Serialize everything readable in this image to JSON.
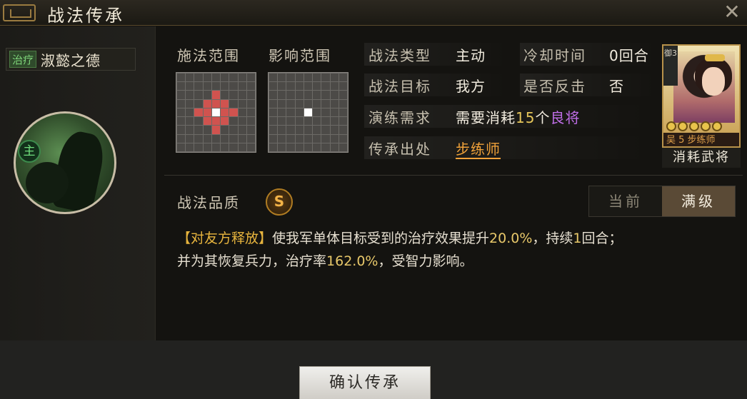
{
  "window": {
    "title": "战法传承"
  },
  "skill": {
    "type_tag": "治疗",
    "name": "淑懿之德",
    "main_badge": "主"
  },
  "ranges": {
    "cast_label": "施法范围",
    "effect_label": "影响范围",
    "cast_grid": {
      "size": 9,
      "red": [
        [
          3,
          4
        ],
        [
          4,
          3
        ],
        [
          4,
          5
        ],
        [
          5,
          4
        ],
        [
          2,
          4
        ],
        [
          4,
          2
        ],
        [
          4,
          6
        ],
        [
          6,
          4
        ],
        [
          3,
          3
        ],
        [
          3,
          5
        ],
        [
          5,
          3
        ],
        [
          5,
          5
        ]
      ],
      "white": [
        [
          4,
          4
        ]
      ]
    },
    "effect_grid": {
      "size": 9,
      "red": [],
      "white": [
        [
          4,
          4
        ]
      ]
    }
  },
  "info": {
    "type_label": "战法类型",
    "type_value": "主动",
    "cooldown_label": "冷却时间",
    "cooldown_value": "0回合",
    "target_label": "战法目标",
    "target_value": "我方",
    "counter_label": "是否反击",
    "counter_value": "否",
    "train_label": "演练需求",
    "train_prefix": "需要消耗",
    "train_count": "15",
    "train_unit": "个",
    "train_quality": "良将",
    "source_label": "传承出处",
    "source_value": "步练师"
  },
  "general_card": {
    "rank_text": "御3",
    "stars": 5,
    "faction_info": "吴 5  步练师",
    "caption": "消耗武将"
  },
  "quality": {
    "label": "战法品质",
    "grade": "S"
  },
  "level_toggle": {
    "current": "当前",
    "max": "满级",
    "active": "max"
  },
  "description": {
    "tag": "【对友方释放】",
    "line1_a": "使我军单体目标受到的治疗效果提升",
    "line1_v1": "20.0%",
    "line1_b": "，持续",
    "line1_v2": "1",
    "line1_c": "回合；",
    "line2_a": "并为其恢复兵力，治疗率",
    "line2_v": "162.0%",
    "line2_b": "，受智力影响。"
  },
  "footer": {
    "confirm_label": "确认传承"
  },
  "colors": {
    "gold": "#e6c65a",
    "purple": "#c06ee8",
    "orange": "#f0a23a",
    "heal_green": "#7fd57a"
  }
}
